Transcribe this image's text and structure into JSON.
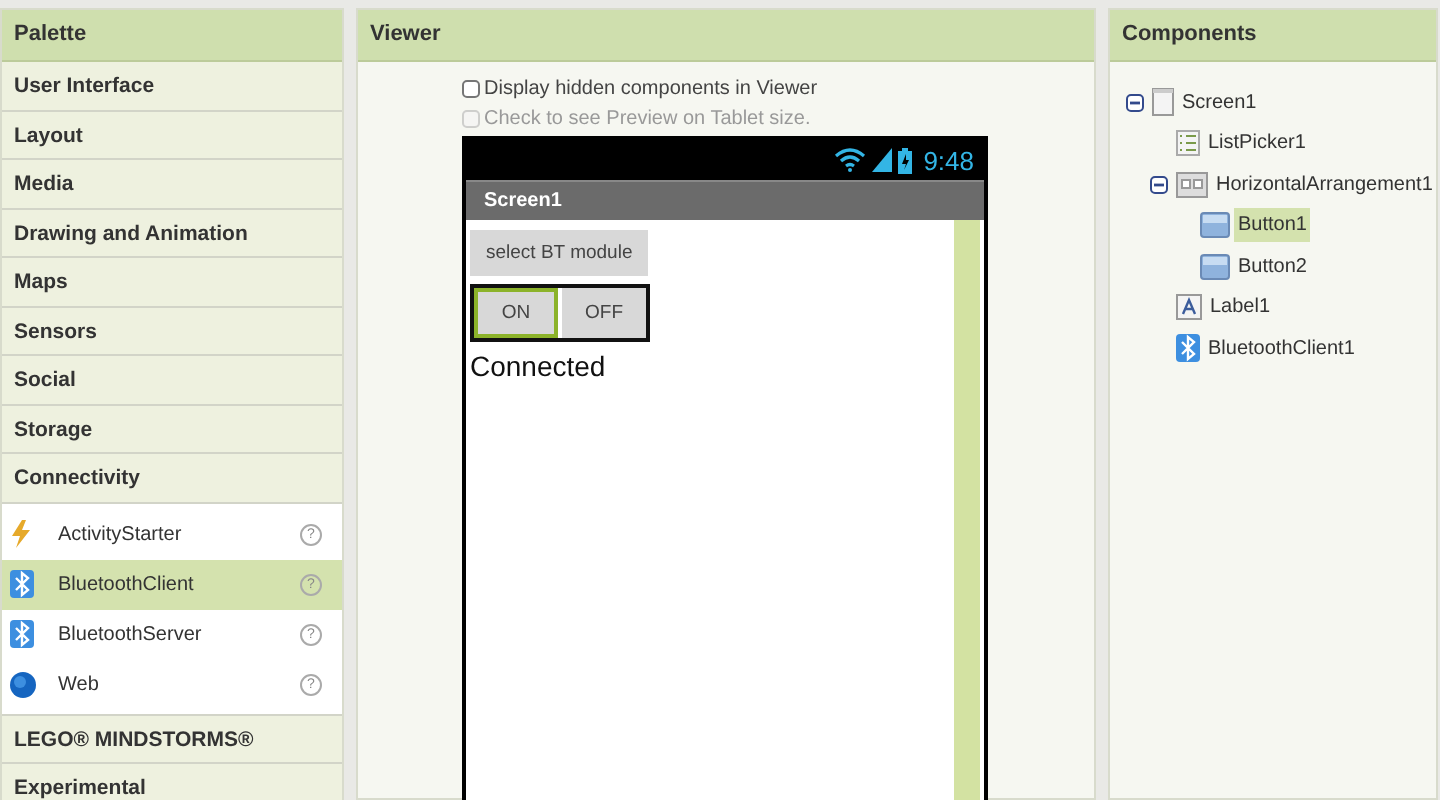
{
  "palette": {
    "title": "Palette",
    "categories": [
      {
        "label": "User Interface"
      },
      {
        "label": "Layout"
      },
      {
        "label": "Media"
      },
      {
        "label": "Drawing and Animation"
      },
      {
        "label": "Maps"
      },
      {
        "label": "Sensors"
      },
      {
        "label": "Social"
      },
      {
        "label": "Storage"
      },
      {
        "label": "Connectivity",
        "items": [
          {
            "label": "ActivityStarter",
            "kind": "activity",
            "selected": false,
            "help": "?"
          },
          {
            "label": "BluetoothClient",
            "kind": "bluetooth",
            "selected": true,
            "help": "?"
          },
          {
            "label": "BluetoothServer",
            "kind": "bluetooth",
            "selected": false,
            "help": "?"
          },
          {
            "label": "Web",
            "kind": "web",
            "selected": false,
            "help": "?"
          }
        ]
      },
      {
        "label": "LEGO® MINDSTORMS®"
      },
      {
        "label": "Experimental"
      }
    ]
  },
  "viewer": {
    "title": "Viewer",
    "options": [
      {
        "label": "Display hidden components in Viewer",
        "checked": false,
        "disabled": false
      },
      {
        "label": "Check to see Preview on Tablet size.",
        "checked": false,
        "disabled": true
      }
    ],
    "phone": {
      "time": "9:48",
      "screen_title": "Screen1",
      "components": [
        {
          "kind": "button",
          "label": "select BT module",
          "selected": false
        },
        {
          "kind": "arrangement",
          "buttons": [
            {
              "label": "ON",
              "selected": true
            },
            {
              "label": "OFF",
              "selected": false
            }
          ]
        },
        {
          "kind": "label",
          "text": "Connected"
        }
      ]
    }
  },
  "components": {
    "title": "Components",
    "tree": [
      {
        "label": "Screen1",
        "kind": "screen",
        "selected": false,
        "expanded": true,
        "children": [
          {
            "label": "ListPicker1",
            "kind": "listpicker",
            "selected": false
          },
          {
            "label": "HorizontalArrangement1",
            "kind": "arrangement",
            "selected": false,
            "expanded": true,
            "children": [
              {
                "label": "Button1",
                "kind": "button",
                "selected": true
              },
              {
                "label": "Button2",
                "kind": "button",
                "selected": false
              }
            ]
          },
          {
            "label": "Label1",
            "kind": "label",
            "selected": false
          },
          {
            "label": "BluetoothClient1",
            "kind": "bluetooth",
            "selected": false
          }
        ]
      }
    ]
  }
}
